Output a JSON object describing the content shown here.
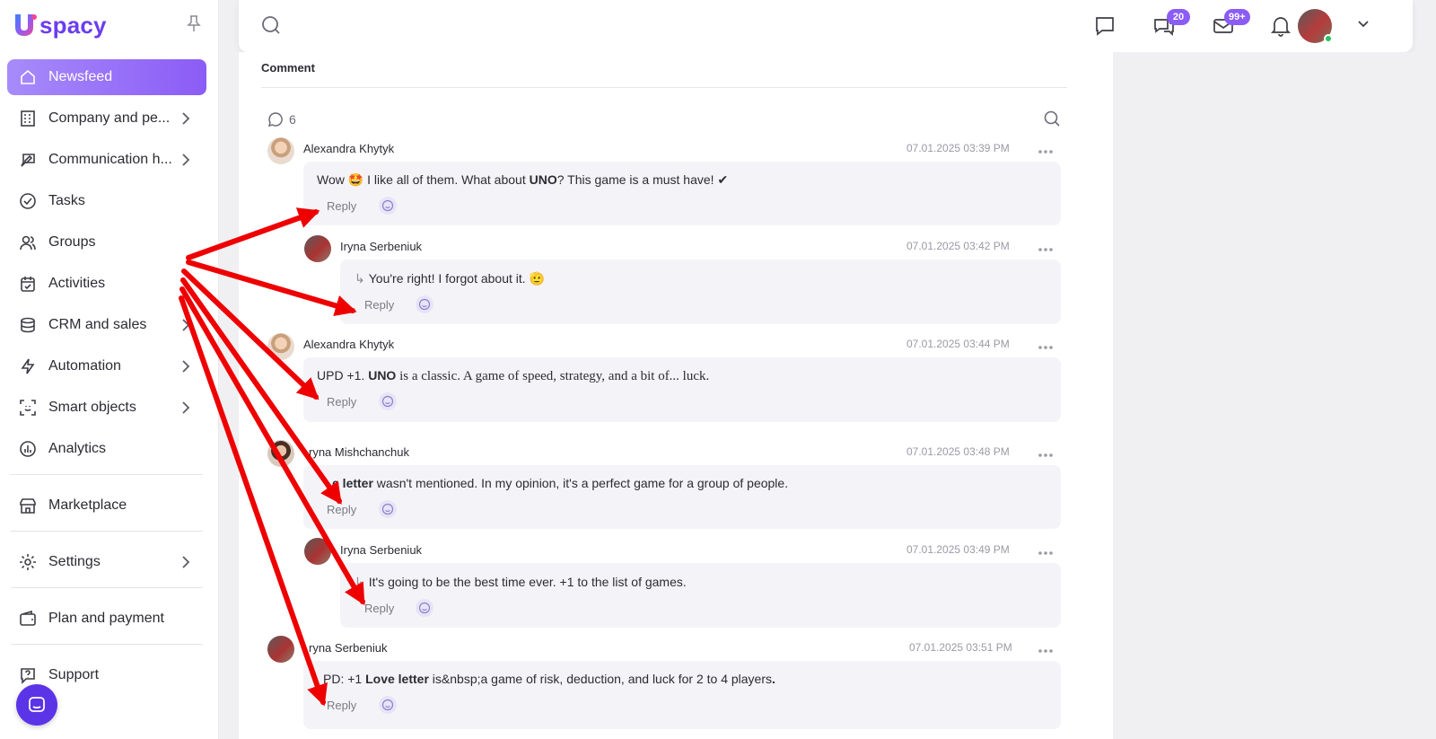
{
  "app": {
    "logo_text": "spacy",
    "brand_color": "#6b3df0",
    "accent_color": "#8b5cf6"
  },
  "sidebar": {
    "items": [
      {
        "label": "Newsfeed",
        "icon": "home-icon",
        "active": true,
        "has_chevron": false
      },
      {
        "label": "Company and pe...",
        "icon": "building-icon",
        "has_chevron": true
      },
      {
        "label": "Communication h...",
        "icon": "chat-edit-icon",
        "has_chevron": true
      },
      {
        "label": "Tasks",
        "icon": "check-circle-icon",
        "has_chevron": false
      },
      {
        "label": "Groups",
        "icon": "users-icon",
        "has_chevron": false
      },
      {
        "label": "Activities",
        "icon": "calendar-check-icon",
        "has_chevron": false
      },
      {
        "label": "CRM and sales",
        "icon": "database-icon",
        "has_chevron": true
      },
      {
        "label": "Automation",
        "icon": "bolt-icon",
        "has_chevron": true
      },
      {
        "label": "Smart objects",
        "icon": "scan-face-icon",
        "has_chevron": true
      },
      {
        "label": "Analytics",
        "icon": "chart-circle-icon",
        "has_chevron": false
      },
      {
        "label": "Marketplace",
        "icon": "store-icon",
        "has_chevron": false
      },
      {
        "label": "Settings",
        "icon": "gear-icon",
        "has_chevron": true
      },
      {
        "label": "Plan and payment",
        "icon": "wallet-icon",
        "has_chevron": false
      },
      {
        "label": "Support",
        "icon": "help-icon",
        "has_chevron": false
      }
    ]
  },
  "header": {
    "badges": {
      "chats": "20",
      "mail": "99+"
    }
  },
  "comments_section": {
    "title": "Comment",
    "count": "6",
    "reply_label": "Reply",
    "comments": [
      {
        "author": "Alexandra Khytyk",
        "date": "07.01.2025 03:39 PM",
        "text_parts": [
          "Wow 🤩 I like all of them. What about ",
          "UNO",
          "? This game is a must have! ✔"
        ],
        "is_reply": false
      },
      {
        "author": "Iryna Serbeniuk",
        "date": "07.01.2025 03:42 PM",
        "text_parts": [
          "You're right! I forgot about it. 🫡"
        ],
        "is_reply": true
      },
      {
        "author": "Alexandra Khytyk",
        "date": "07.01.2025 03:44 PM",
        "text_parts": [
          "UPD +1. ",
          "UNO",
          " is a classic. A game of speed, strategy, and a bit of... luck."
        ],
        "is_reply": false
      },
      {
        "author": "ryna Mishchanchuk",
        "date": "07.01.2025 03:48 PM",
        "text_parts": [
          "e letter",
          " wasn't mentioned. In my opinion, it's a perfect game for a group of people."
        ],
        "is_reply": false
      },
      {
        "author": "Iryna Serbeniuk",
        "date": "07.01.2025 03:49 PM",
        "text_parts": [
          "It's going to be the best time ever. +1 to the list of games."
        ],
        "is_reply": true
      },
      {
        "author": "ryna Serbeniuk",
        "date": "07.01.2025 03:51 PM",
        "text_parts": [
          "PD: +1 ",
          "Love letter",
          " is&nbsp;a game of risk, deduction, and luck for 2 to 4 players",
          "."
        ],
        "is_reply": false
      }
    ]
  }
}
